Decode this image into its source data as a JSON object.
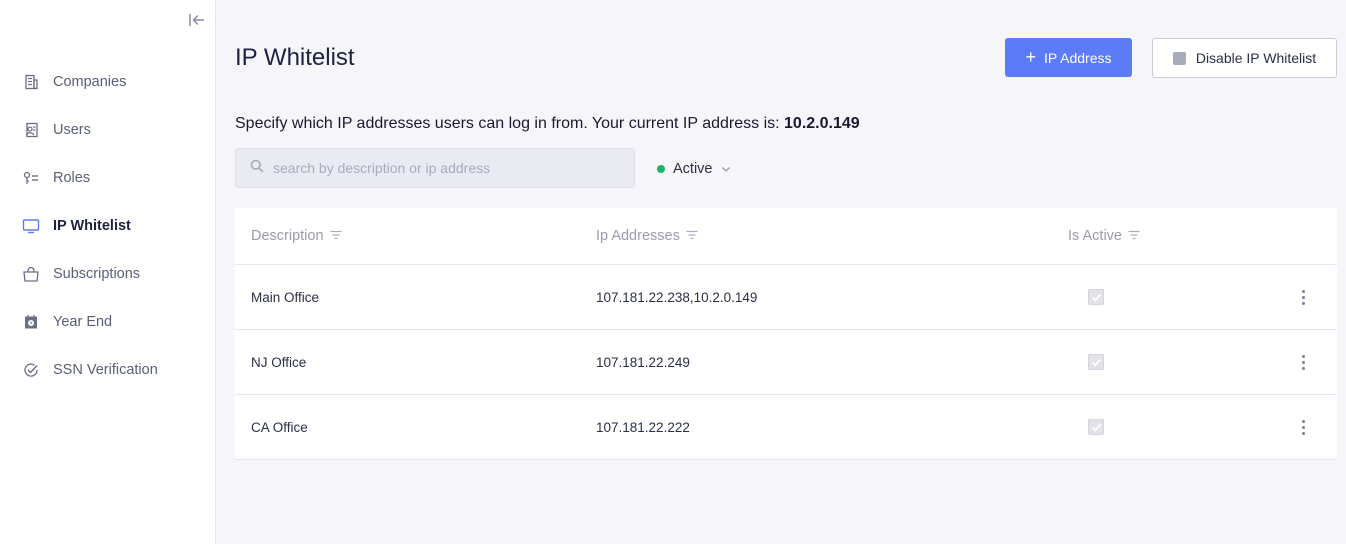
{
  "sidebar": {
    "items": [
      {
        "label": "Companies",
        "icon": "building-icon",
        "active": false
      },
      {
        "label": "Users",
        "icon": "user-badge-icon",
        "active": false
      },
      {
        "label": "Roles",
        "icon": "key-list-icon",
        "active": false
      },
      {
        "label": "IP Whitelist",
        "icon": "monitor-icon",
        "active": true
      },
      {
        "label": "Subscriptions",
        "icon": "shopping-bag-icon",
        "active": false
      },
      {
        "label": "Year End",
        "icon": "calendar-clock-icon",
        "active": false
      },
      {
        "label": "SSN Verification",
        "icon": "check-circle-icon",
        "active": false
      }
    ]
  },
  "header": {
    "title": "IP Whitelist",
    "add_button_label": "IP Address",
    "disable_button_label": "Disable IP Whitelist"
  },
  "subtitle": {
    "text": "Specify which IP addresses users can log in from. Your current IP address is: ",
    "current_ip": "10.2.0.149"
  },
  "search": {
    "placeholder": "search by description or ip address",
    "value": ""
  },
  "status_filter": {
    "label": "Active"
  },
  "table": {
    "columns": {
      "description": "Description",
      "ip_addresses": "Ip Addresses",
      "is_active": "Is Active"
    },
    "rows": [
      {
        "description": "Main Office",
        "ip_addresses": "107.181.22.238,10.2.0.149",
        "is_active": true
      },
      {
        "description": "NJ Office",
        "ip_addresses": "107.181.22.249",
        "is_active": true
      },
      {
        "description": "CA Office",
        "ip_addresses": "107.181.22.222",
        "is_active": true
      }
    ]
  },
  "colors": {
    "primary": "#5b7cf6",
    "active_dot": "#1bb36a",
    "sidebar_bg": "#ffffff",
    "main_bg": "#f5f5fa"
  }
}
